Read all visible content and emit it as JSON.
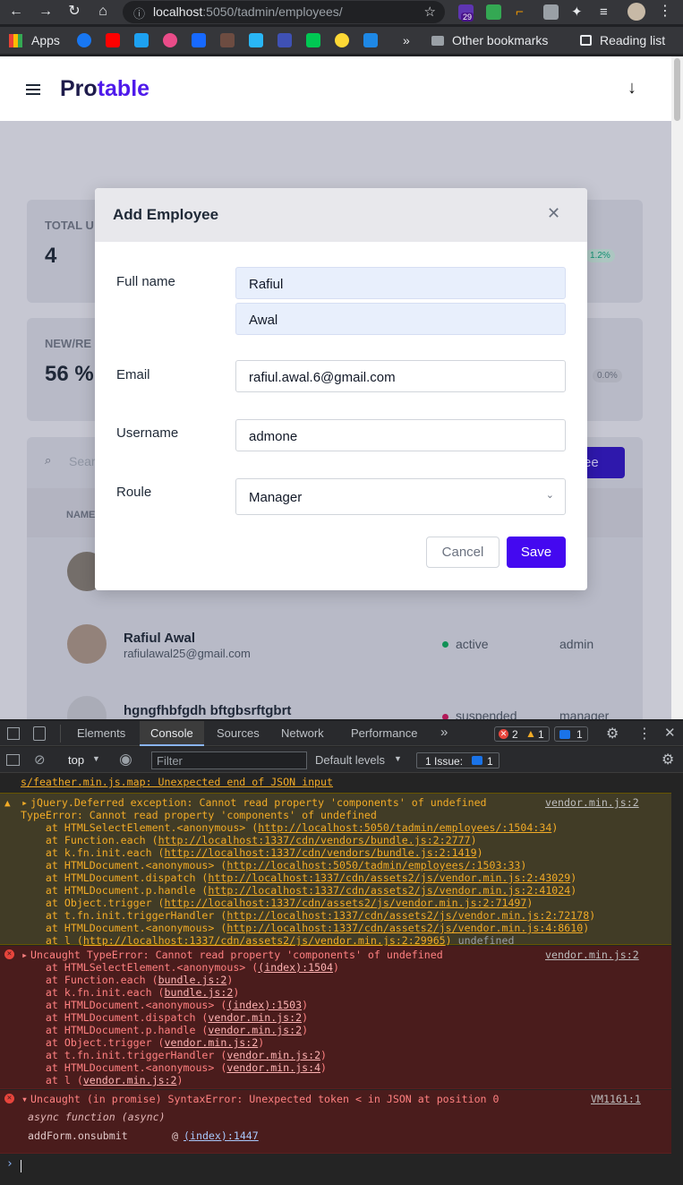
{
  "browser": {
    "url_host": "localhost",
    "url_path": ":5050/tadmin/employees/",
    "ext_badge": "29",
    "bookmarks": {
      "apps": "Apps",
      "other": "Other bookmarks",
      "reading": "Reading list",
      "more": "»"
    }
  },
  "app": {
    "brand_a": "Pro",
    "brand_b": "table",
    "bg": {
      "total_label": "TOTAL U",
      "total_value": "4",
      "total_change": "1.2%",
      "new_label": "NEW/RE",
      "new_value": "56 %",
      "new_change": "0.0%",
      "search_placeholder": "Sear",
      "add_btn": "ee",
      "col_name": "NAME",
      "rows": [
        {
          "name": "Rafiul Awal",
          "email": "rafiulawal25@gmail.com",
          "status": "active",
          "role": "admin"
        },
        {
          "name": "hgngfhbfgdh bftgbsrftgbrt",
          "email": "",
          "status": "suspended",
          "role": "manager"
        }
      ]
    }
  },
  "modal": {
    "title": "Add Employee",
    "fullname_label": "Full name",
    "first_name": "Rafiul",
    "last_name": "Awal",
    "email_label": "Email",
    "email": "rafiul.awal.6@gmail.com",
    "username_label": "Username",
    "username": "admone",
    "role_label": "Roule",
    "role": "Manager",
    "cancel": "Cancel",
    "save": "Save"
  },
  "devtools": {
    "tabs": [
      "Elements",
      "Console",
      "Sources",
      "Network",
      "Performance",
      "»"
    ],
    "errors": "2",
    "warnings": "1",
    "messages": "1",
    "context": "top",
    "filter_placeholder": "Filter",
    "levels": "Default levels",
    "issues_label": "1 Issue:",
    "issues_count": "1",
    "map_line": "s/feather.min.js.map: Unexpected end of JSON input",
    "warn": {
      "head": "jQuery.Deferred exception: Cannot read property 'components' of undefined",
      "src": "vendor.min.js:2",
      "line2": "TypeError: Cannot read property 'components' of undefined",
      "stack": [
        [
          "    at HTMLSelectElement.<anonymous> (",
          "http://localhost:5050/tadmin/employees/:1504:34",
          ")"
        ],
        [
          "    at Function.each (",
          "http://localhost:1337/cdn/vendors/bundle.js:2:2777",
          ")"
        ],
        [
          "    at k.fn.init.each (",
          "http://localhost:1337/cdn/vendors/bundle.js:2:1419",
          ")"
        ],
        [
          "    at HTMLDocument.<anonymous> (",
          "http://localhost:5050/tadmin/employees/:1503:33",
          ")"
        ],
        [
          "    at HTMLDocument.dispatch (",
          "http://localhost:1337/cdn/assets2/js/vendor.min.js:2:43029",
          ")"
        ],
        [
          "    at HTMLDocument.p.handle (",
          "http://localhost:1337/cdn/assets2/js/vendor.min.js:2:41024",
          ")"
        ],
        [
          "    at Object.trigger (",
          "http://localhost:1337/cdn/assets2/js/vendor.min.js:2:71497",
          ")"
        ],
        [
          "    at t.fn.init.triggerHandler (",
          "http://localhost:1337/cdn/assets2/js/vendor.min.js:2:72178",
          ")"
        ],
        [
          "    at HTMLDocument.<anonymous> (",
          "http://localhost:1337/cdn/assets2/js/vendor.min.js:4:8610",
          ")"
        ],
        [
          "    at l (",
          "http://localhost:1337/cdn/assets2/js/vendor.min.js:2:29965",
          ") "
        ]
      ],
      "undefined": "undefined"
    },
    "err1": {
      "head": "Uncaught TypeError: Cannot read property 'components' of undefined",
      "src": "vendor.min.js:2",
      "stack": [
        [
          "    at HTMLSelectElement.<anonymous> (",
          "(index):1504",
          ")"
        ],
        [
          "    at Function.each (",
          "bundle.js:2",
          ")"
        ],
        [
          "    at k.fn.init.each (",
          "bundle.js:2",
          ")"
        ],
        [
          "    at HTMLDocument.<anonymous> (",
          "(index):1503",
          ")"
        ],
        [
          "    at HTMLDocument.dispatch (",
          "vendor.min.js:2",
          ")"
        ],
        [
          "    at HTMLDocument.p.handle (",
          "vendor.min.js:2",
          ")"
        ],
        [
          "    at Object.trigger (",
          "vendor.min.js:2",
          ")"
        ],
        [
          "    at t.fn.init.triggerHandler (",
          "vendor.min.js:2",
          ")"
        ],
        [
          "    at HTMLDocument.<anonymous> (",
          "vendor.min.js:4",
          ")"
        ],
        [
          "    at l (",
          "vendor.min.js:2",
          ")"
        ]
      ]
    },
    "err2": {
      "head": "Uncaught (in promise) SyntaxError: Unexpected token < in JSON at position 0",
      "src": "VM1161:1",
      "async": "async function (async)",
      "frame": "addForm.onsubmit",
      "at": "@ ",
      "frame_src": "(index):1447"
    }
  }
}
